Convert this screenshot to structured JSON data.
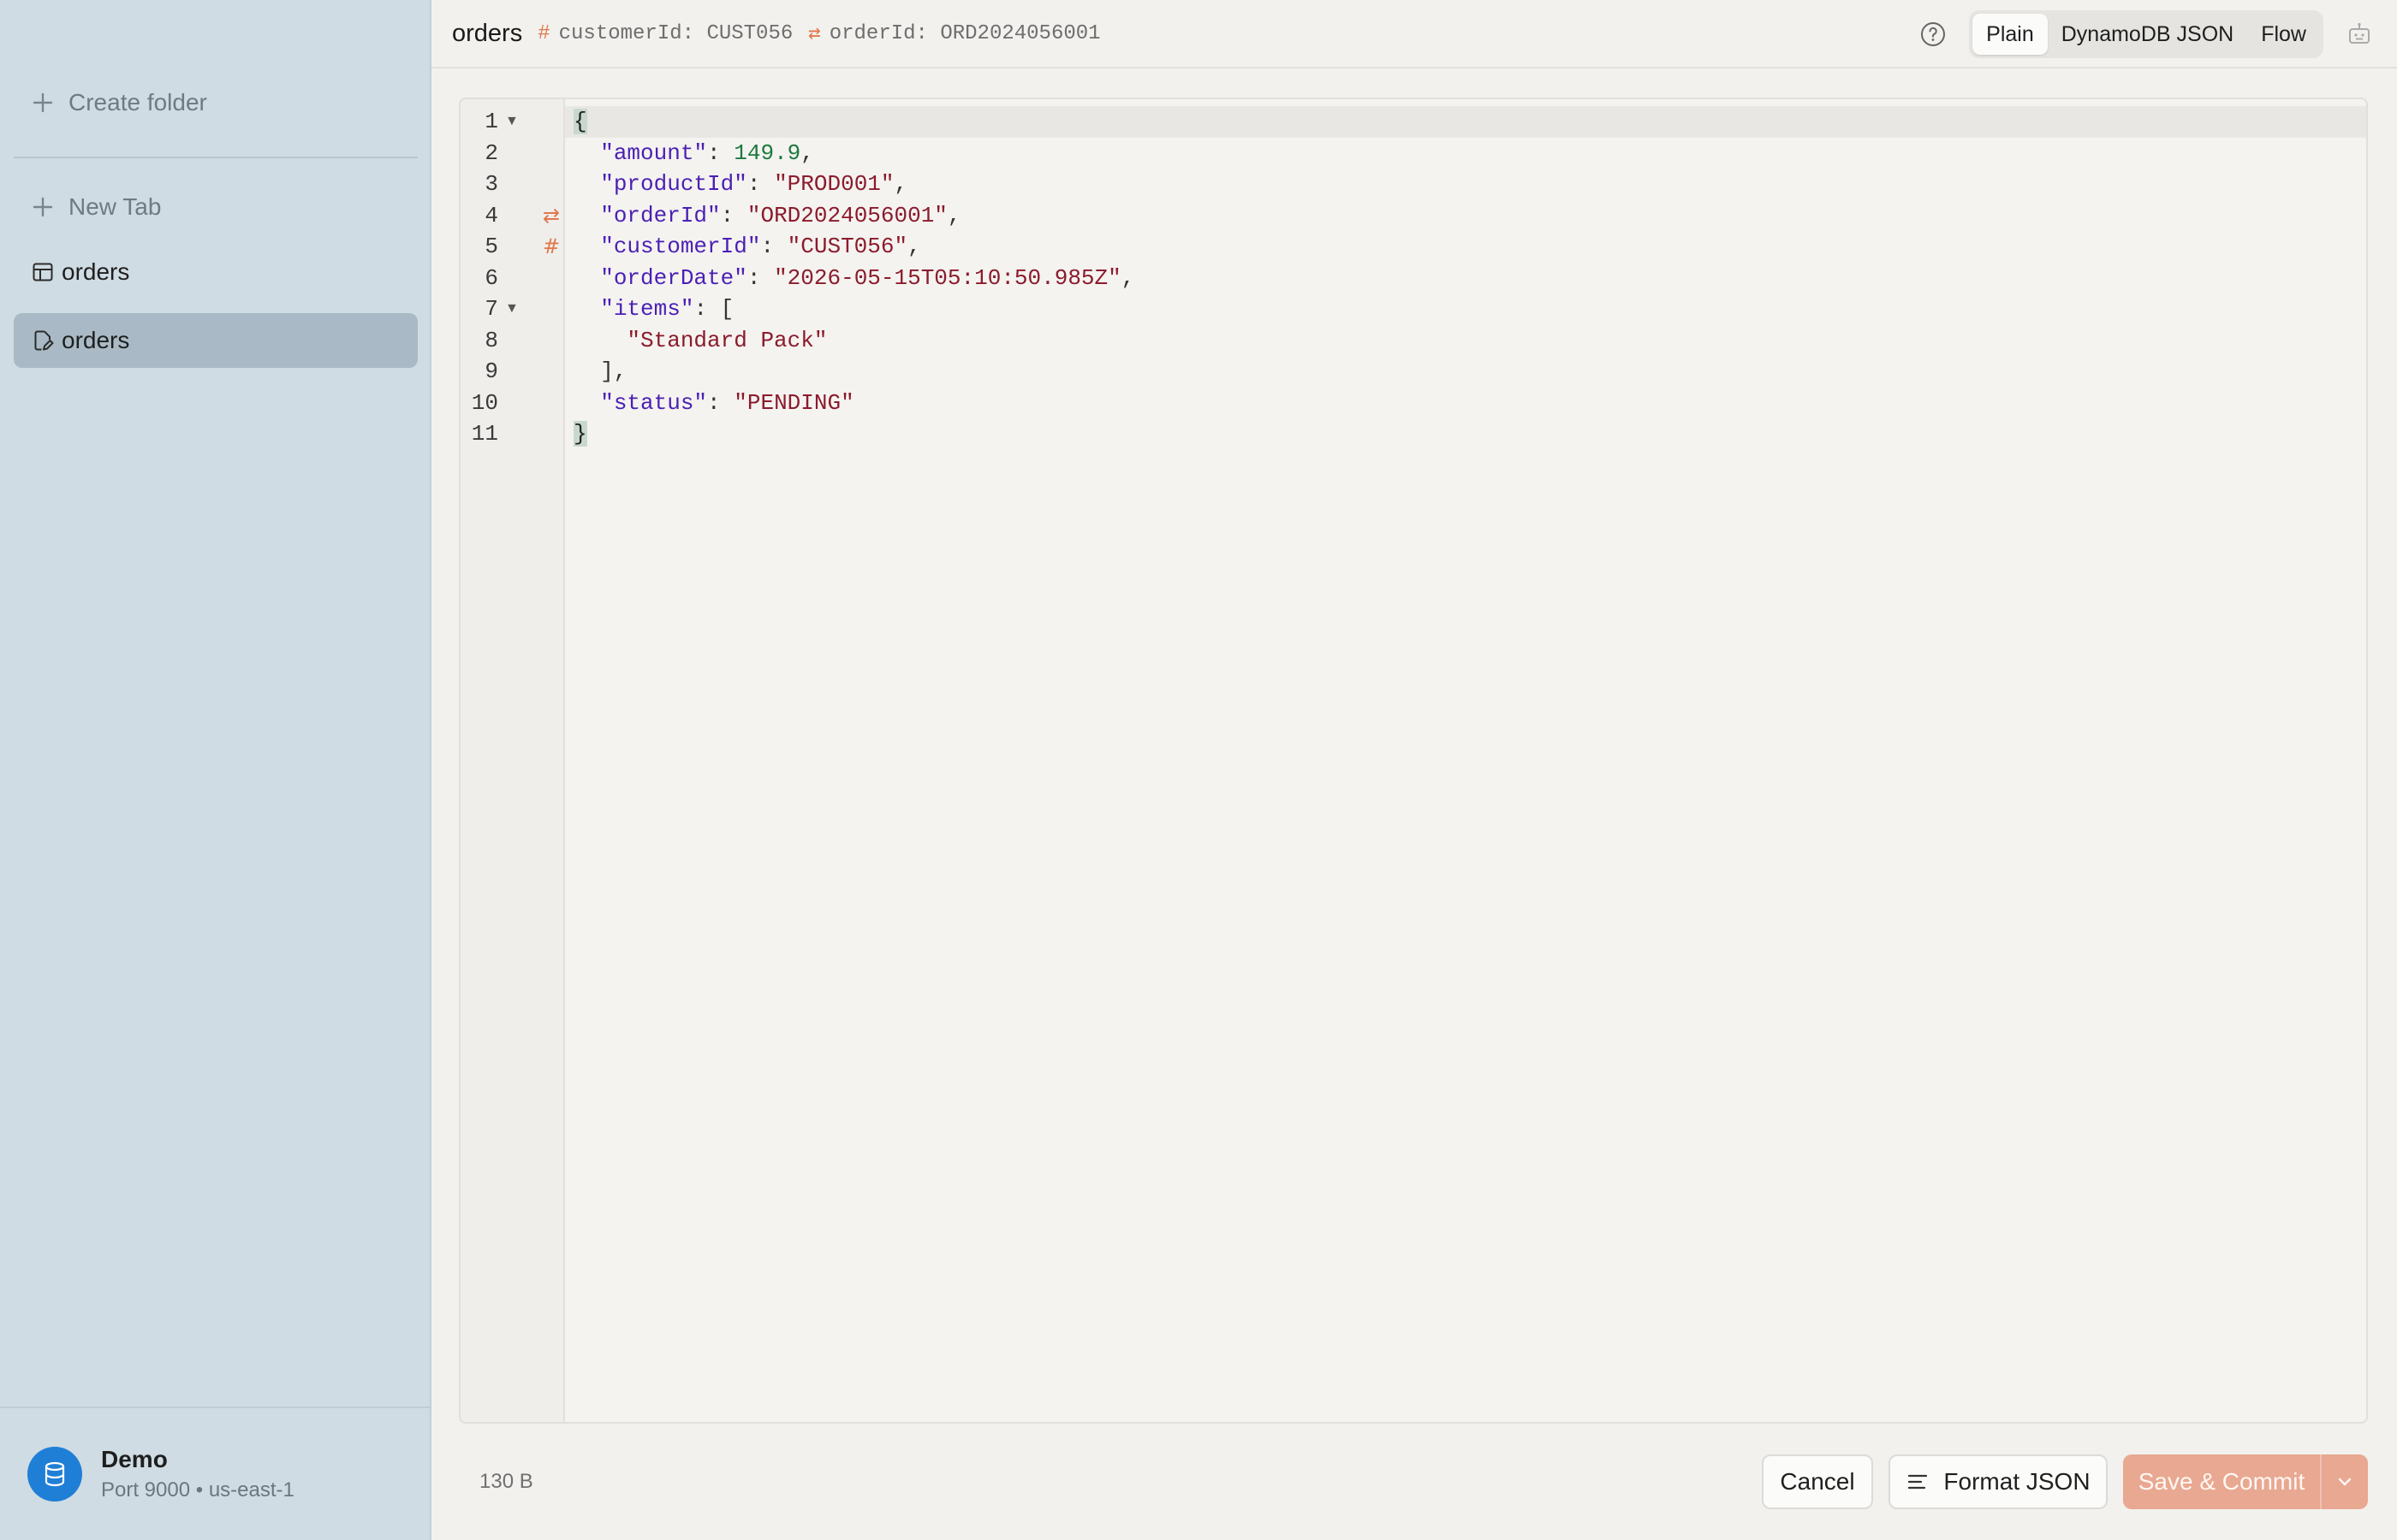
{
  "sidebar": {
    "create_folder": "Create folder",
    "new_tab": "New Tab",
    "items": [
      {
        "label": "orders",
        "icon": "table-icon"
      },
      {
        "label": "orders",
        "icon": "document-edit-icon"
      }
    ],
    "connection": {
      "name": "Demo",
      "details": "Port 9000 • us-east-1"
    }
  },
  "header": {
    "title": "orders",
    "partition_key": "customerId: CUST056",
    "sort_key": "orderId: ORD2024056001",
    "views": [
      "Plain",
      "DynamoDB JSON",
      "Flow"
    ],
    "active_view": "Plain"
  },
  "editor": {
    "line_numbers": [
      "1",
      "2",
      "3",
      "4",
      "5",
      "6",
      "7",
      "8",
      "9",
      "10",
      "11"
    ],
    "lines": {
      "amount_key": "\"amount\"",
      "amount_val": "149.9",
      "productId_key": "\"productId\"",
      "productId_val": "\"PROD001\"",
      "orderId_key": "\"orderId\"",
      "orderId_val": "\"ORD2024056001\"",
      "customerId_key": "\"customerId\"",
      "customerId_val": "\"CUST056\"",
      "orderDate_key": "\"orderDate\"",
      "orderDate_val": "\"2026-05-15T05:10:50.985Z\"",
      "items_key": "\"items\"",
      "items_0": "\"Standard Pack\"",
      "status_key": "\"status\"",
      "status_val": "\"PENDING\""
    }
  },
  "footer": {
    "size": "130 B",
    "cancel": "Cancel",
    "format": "Format JSON",
    "save": "Save & Commit"
  },
  "colors": {
    "accent": "#e0784c",
    "save_button": "#e8a891",
    "db_avatar": "#1f7fd6"
  }
}
